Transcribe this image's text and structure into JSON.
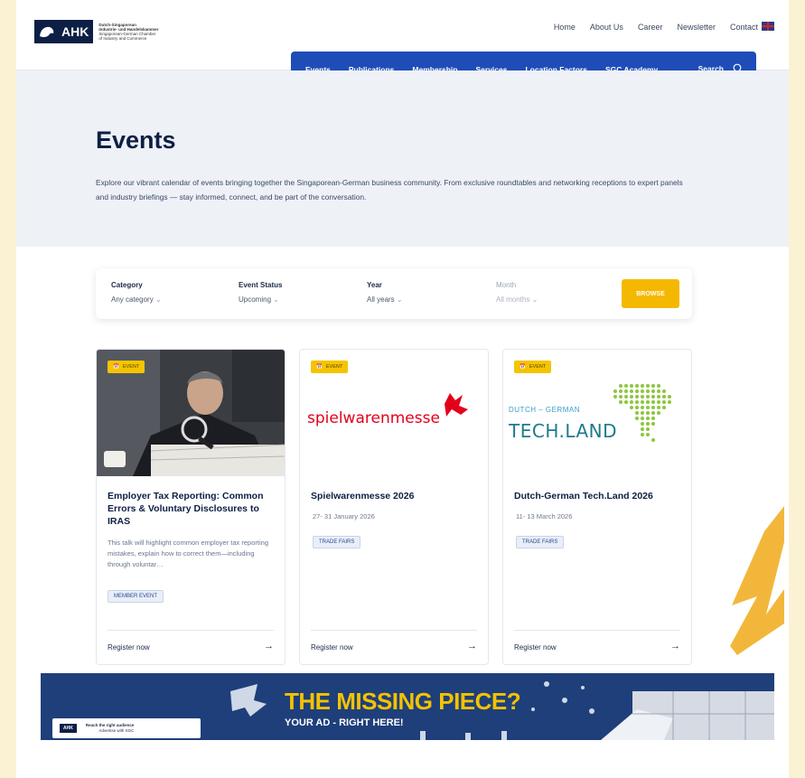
{
  "header": {
    "logo_mark": "AHK",
    "logo_lines": [
      "Dutch-Singaporean",
      "Industrie- und Handelskammer",
      "Singaporean-German Chamber",
      "of Industry and Commerce"
    ],
    "topnav": [
      "Home",
      "About Us",
      "Career",
      "Newsletter",
      "Contact"
    ],
    "language_flag": "uk-flag-icon"
  },
  "mainnav": {
    "items": [
      "Events",
      "Publications",
      "Membership",
      "Services",
      "Location Factors",
      "SGC Academy"
    ],
    "active": "Events",
    "search_label": "Search"
  },
  "hero": {
    "title": "Events",
    "description": "Explore our vibrant calendar of events bringing together the Singaporean-German business community. From exclusive roundtables and networking receptions to expert panels and industry briefings — stay informed, connect, and be part of the conversation."
  },
  "filters": {
    "category": {
      "label": "Category",
      "value": "Any category"
    },
    "status": {
      "label": "Event Status",
      "value": "Upcoming"
    },
    "year": {
      "label": "Year",
      "value": "All years"
    },
    "month": {
      "label": "Month",
      "value": "All months"
    },
    "browse_label": "BROWSE"
  },
  "cards": [
    {
      "badge": "EVENT",
      "title": "Employer Tax Reporting: Common Errors & Voluntary Disclosures to IRAS",
      "description": "This talk will highlight common employer tax reporting mistakes, explain how to correct them—including through voluntar…",
      "tag": "MEMBER EVENT",
      "cta": "Register now"
    },
    {
      "badge": "EVENT",
      "logo_text": "spielwarenmesse",
      "title": "Spielwarenmesse 2026",
      "date": "27- 31 January 2026",
      "tag": "TRADE FAIRS",
      "cta": "Register now"
    },
    {
      "badge": "EVENT",
      "logo_line1": "DUTCH – GERMAN",
      "logo_line2": "TECH.LAND",
      "title": "Dutch-German Tech.Land 2026",
      "date": "11- 13 March 2026",
      "tag": "TRADE FAIRS",
      "cta": "Register now"
    }
  ],
  "ad": {
    "headline": "THE MISSING PIECE?",
    "subline": "YOUR AD - RIGHT HERE!",
    "mini_logo": "AHK",
    "mini_line1": "Reach the right audience",
    "mini_line2": "Advertise with SGC"
  },
  "colors": {
    "brand_blue": "#1e4db8",
    "navy": "#0d1f44",
    "accent_yellow": "#f5b800",
    "overlay_arrow": "#f2b73a"
  }
}
